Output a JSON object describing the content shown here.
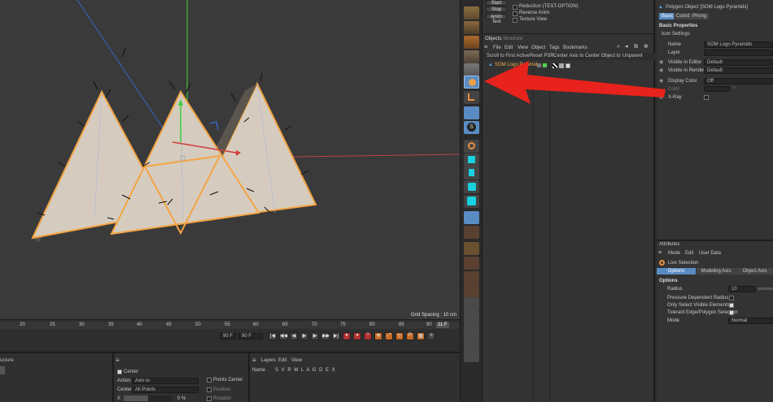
{
  "colors": {
    "accent": "#f4a443",
    "selected_blue": "#5a8cc4",
    "arrow_red": "#e8221c",
    "cyan": "#18d2e3",
    "blue_axis": "#3b65c8",
    "green_axis": "#3fd23e",
    "red_axis": "#d23a3a"
  },
  "top_controls": {
    "start": "Start",
    "stop": "Stop",
    "anim_test": "Anim Test",
    "options": [
      "Reduction (TEST-OPTION)",
      "Reverse Anim",
      "Texture View"
    ]
  },
  "viewport": {
    "grid_spacing": "Grid Spacing : 10 cm"
  },
  "timeline": {
    "ticks": [
      "20",
      "25",
      "30",
      "35",
      "40",
      "45",
      "50",
      "55",
      "60",
      "65",
      "70",
      "75",
      "80",
      "85",
      "90"
    ],
    "current_frame": "11 F",
    "start_field": "90 F",
    "end_field": "90 F"
  },
  "bottom": {
    "left_label": "ucture",
    "center_label": "Center",
    "action_label": "Action",
    "action_value": "Axis to",
    "center_field_label": "Center",
    "center_field_value": "All Points",
    "x_label": "X",
    "x_value": "0 %",
    "points_center": "Points Center",
    "position": "Position",
    "rotation": "Rotation",
    "layers_menu": [
      "Layers",
      "Edit",
      "View"
    ],
    "layers_col_name": "Name",
    "layers_cols": "S V R M L A G D E X"
  },
  "objects": {
    "tabs": [
      "Objects",
      "Structure"
    ],
    "menu": [
      "File",
      "Edit",
      "View",
      "Object",
      "Tags",
      "Bookmarks"
    ],
    "toolbar": [
      "Scroll to First Active",
      "Reset PSR",
      "Center Axis to",
      "Center Object to",
      "Unparent"
    ],
    "item": "SOM Logo Pyramid"
  },
  "attributes_top": {
    "header": "Polygon Object [SOM Logo Pyramids]",
    "tabs": [
      "Basic",
      "Coord.",
      "Phong"
    ],
    "section": "Basic Properties",
    "subsection": "Icon Settings",
    "rows": [
      {
        "label": "Name",
        "value": "SOM Logo Pyramids"
      },
      {
        "label": "Layer",
        "value": ""
      },
      {
        "label": "Visible in Editor",
        "value": "Default"
      },
      {
        "label": "Visible in Renderer",
        "value": "Default"
      },
      {
        "label": "Display Color",
        "value": "Off"
      },
      {
        "label": "Color",
        "value": ""
      },
      {
        "label": "X-Ray",
        "value": ""
      }
    ]
  },
  "attributes_bottom": {
    "title": "Attributes",
    "menu": [
      "Mode",
      "Edit",
      "User Data"
    ],
    "tool": "Live Selection",
    "tabs": [
      "Options",
      "Modeling Axis",
      "Object Axis"
    ],
    "section": "Options",
    "rows": [
      {
        "label": "Radius",
        "value": "10"
      },
      {
        "label": "Pressure Dependent Radius",
        "value": ""
      },
      {
        "label": "Only Select Visible Elements",
        "value": ""
      },
      {
        "label": "Tolerant Edge/Polygon Selection",
        "value": ""
      },
      {
        "label": "Mode",
        "value": "Normal"
      }
    ]
  }
}
